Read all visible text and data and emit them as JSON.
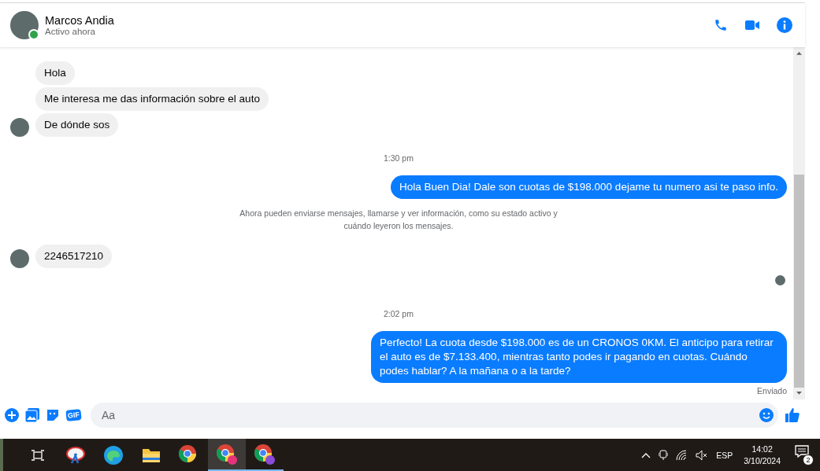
{
  "header": {
    "name": "Marcos Andia",
    "status": "Activo ahora",
    "online": true
  },
  "messages": [
    {
      "kind": "incoming",
      "text": "Hola",
      "avatar": false
    },
    {
      "kind": "incoming",
      "text": "Me interesa me das información sobre el auto",
      "avatar": false
    },
    {
      "kind": "incoming",
      "text": "De dónde sos",
      "avatar": true
    },
    {
      "kind": "time",
      "text": "1:30 pm"
    },
    {
      "kind": "outgoing",
      "text": "Hola Buen Dia! Dale son cuotas de $198.000 dejame tu numero asi te paso info."
    },
    {
      "kind": "notice",
      "text": "Ahora pueden enviarse mensajes, llamarse y ver información, como su estado activo y cuándo leyeron los mensajes."
    },
    {
      "kind": "incoming",
      "text": "2246517210",
      "avatar": true
    },
    {
      "kind": "seen"
    },
    {
      "kind": "time",
      "text": "2:02 pm"
    },
    {
      "kind": "outgoing",
      "text": "Perfecto! La cuota desde $198.000 es de un CRONOS 0KM. El anticipo para retirar el auto es de $7.133.400, mientras tanto podes ir pagando en cuotas. Cuándo podes hablar? A la mañana o a la tarde?"
    },
    {
      "kind": "status",
      "text": "Enviado"
    }
  ],
  "composer": {
    "gif_label": "GIF",
    "placeholder": "Aa"
  },
  "taskbar": {
    "apps": [
      {
        "kind": "taskview",
        "selected": false,
        "running": false
      },
      {
        "kind": "snip",
        "selected": false,
        "running": false
      },
      {
        "kind": "edge",
        "selected": false,
        "running": false
      },
      {
        "kind": "folder",
        "selected": false,
        "running": false
      },
      {
        "kind": "chrome",
        "selected": false,
        "running": false
      },
      {
        "kind": "chrome-profile",
        "selected": true,
        "running": true,
        "color": "#e8327c"
      },
      {
        "kind": "chrome-profile",
        "selected": false,
        "running": true,
        "color": "#8a4bd6"
      }
    ],
    "language": "ESP",
    "time": "14:02",
    "date": "3/10/2024",
    "notifications": "2"
  }
}
